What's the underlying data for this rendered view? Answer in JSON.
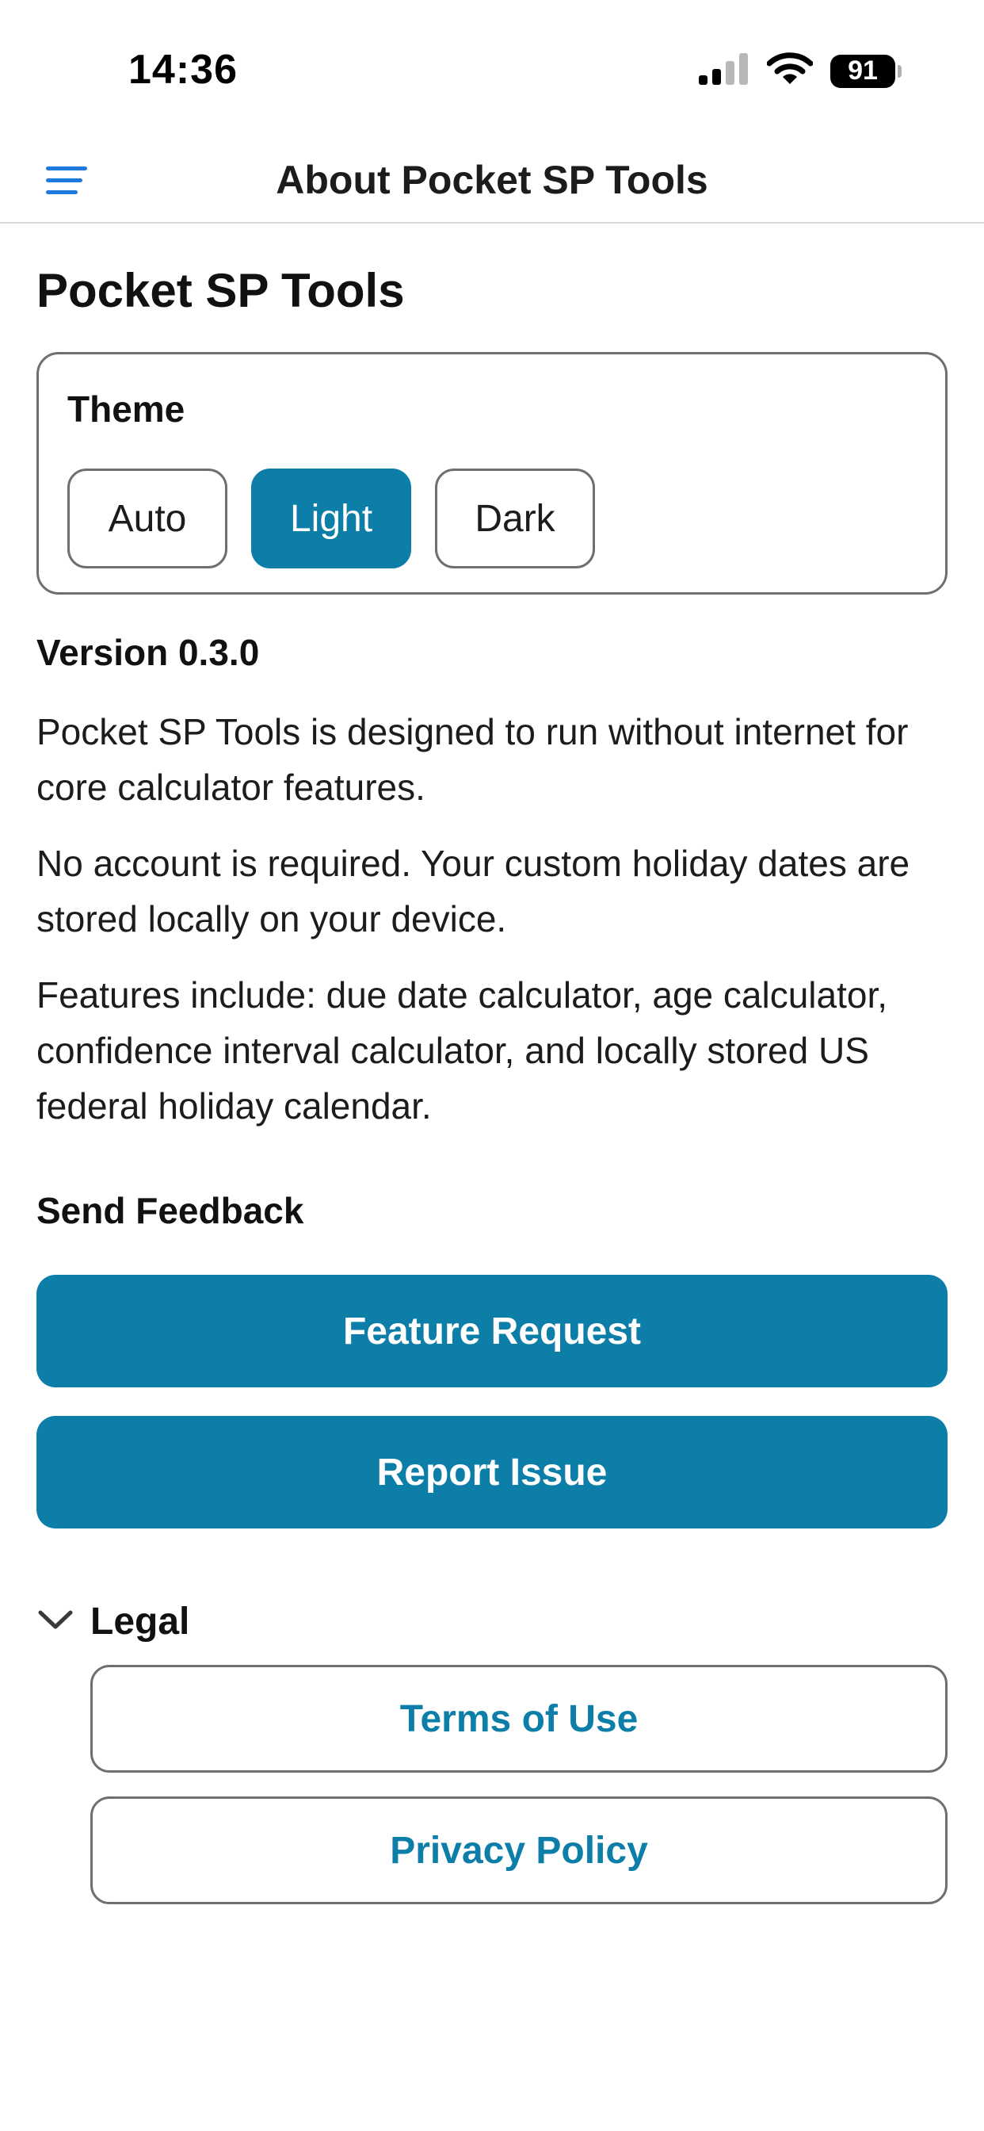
{
  "status_bar": {
    "time": "14:36",
    "battery": "91",
    "icons": [
      "cellular-signal-icon",
      "wifi-icon",
      "battery-icon"
    ]
  },
  "navbar": {
    "title": "About Pocket SP Tools",
    "menu_icon": "hamburger-menu-icon"
  },
  "page": {
    "title": "Pocket SP Tools"
  },
  "theme": {
    "label": "Theme",
    "options": [
      "Auto",
      "Light",
      "Dark"
    ],
    "selected": "Light"
  },
  "about": {
    "version": "Version 0.3.0",
    "paragraphs": [
      "Pocket SP Tools is designed to run without internet for core calculator features.",
      "No account is required. Your custom holiday dates are stored locally on your device.",
      "Features include: due date calculator, age calculator, confidence interval calculator, and locally stored US federal holiday calendar."
    ]
  },
  "feedback": {
    "heading": "Send Feedback",
    "feature_request": "Feature Request",
    "report_issue": "Report Issue"
  },
  "legal": {
    "title": "Legal",
    "expanded": true,
    "terms": "Terms of Use",
    "privacy": "Privacy Policy"
  },
  "colors": {
    "accent": "#0c7ea8",
    "nav_icon": "#1f7ae0",
    "border": "#6e6e73",
    "text": "#1c1c1e"
  }
}
